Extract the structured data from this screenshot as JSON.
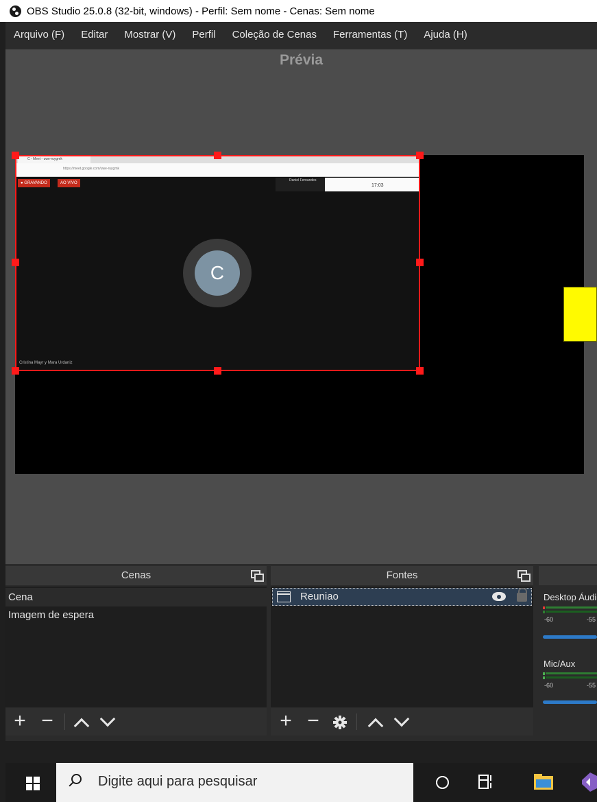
{
  "window": {
    "title": "OBS Studio 25.0.8 (32-bit, windows) - Perfil: Sem nome - Cenas: Sem nome"
  },
  "menu": [
    "Arquivo (F)",
    "Editar",
    "Mostrar (V)",
    "Perfil",
    "Coleção de Cenas",
    "Ferramentas (T)",
    "Ajuda (H)"
  ],
  "preview": {
    "label": "Prévia",
    "source_avatar_letter": "C",
    "captured": {
      "tab_title": "C - Meet - uwe-ruygmk",
      "url": "https://meet.google.com/uwe-ruygmk",
      "recording_badge": "● GRAVANDO",
      "live_badge": "AO VIVO",
      "presenter": "Daniel Fernandes",
      "time": "17:03",
      "caption": "Cristina Mayr y Mara Urdaniz"
    }
  },
  "scenes": {
    "header": "Cenas",
    "items": [
      "Cena",
      "Imagem de espera"
    ],
    "selected": 0
  },
  "sources": {
    "header": "Fontes",
    "items": [
      {
        "name": "Reuniao",
        "visible": true,
        "locked": false,
        "icon": "window-capture-icon"
      }
    ]
  },
  "mixer": {
    "channels": [
      {
        "name": "Desktop Áudio",
        "ticks": [
          "-60",
          "-55"
        ]
      },
      {
        "name": "Mic/Aux",
        "ticks": [
          "-60",
          "-55"
        ]
      }
    ]
  },
  "taskbar": {
    "search_placeholder": "Digite aqui para pesquisar",
    "icons": [
      "windows-start-icon",
      "search-icon",
      "cortana-icon",
      "task-view-icon",
      "file-explorer-icon",
      "visual-studio-icon"
    ]
  },
  "colors": {
    "selection": "#ff1a1a",
    "source_highlight": "#2d3e52",
    "meter_green": "#2e7d32",
    "slider_blue": "#2d7ac8",
    "yellow_source": "#fffa00"
  }
}
